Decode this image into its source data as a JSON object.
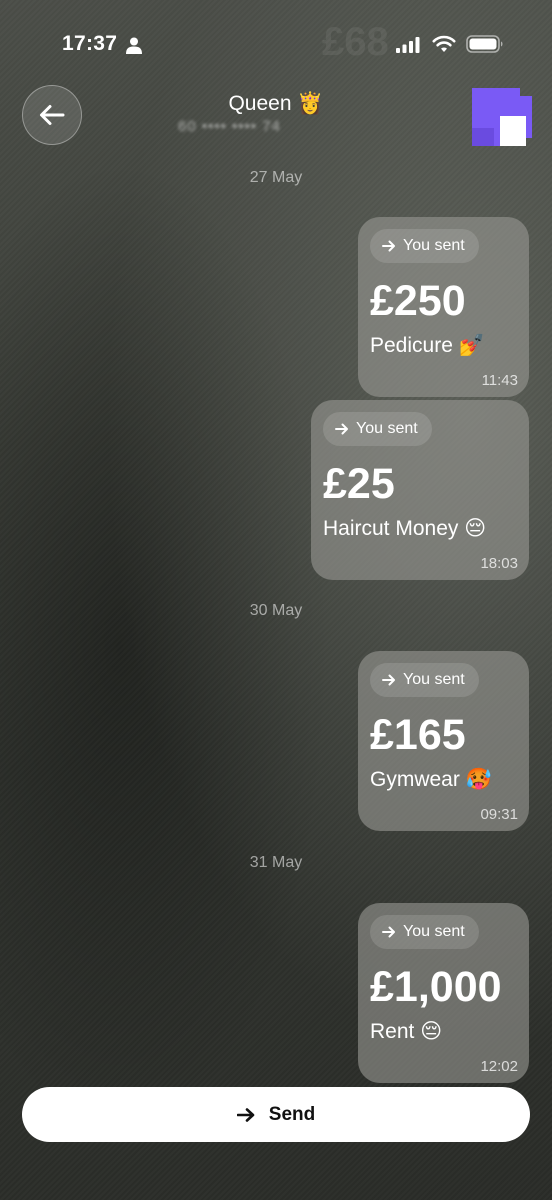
{
  "status_bar": {
    "time": "17:37",
    "person_icon": "person-icon",
    "icons": [
      "signal-icon",
      "wifi-icon",
      "battery-icon"
    ],
    "ghost_amount": "£68"
  },
  "header": {
    "back_icon": "arrow-left-icon",
    "contact_name": "Queen 👸",
    "contact_sub": "60 •••• •••• 74",
    "avatar_color": "#7a5af5"
  },
  "messages": [
    {
      "date": "27 May"
    },
    {
      "pill": "You sent",
      "amount": "£250",
      "note": "Pedicure 💅",
      "time": "11:43"
    },
    {
      "pill": "You sent",
      "amount": "£25",
      "note": "Haircut Money 😔",
      "time": "18:03"
    },
    {
      "date": "30 May"
    },
    {
      "pill": "You sent",
      "amount": "£165",
      "note": "Gymwear 🥵",
      "time": "09:31"
    },
    {
      "date": "31 May"
    },
    {
      "pill": "You sent",
      "amount": "£1,000",
      "note": "Rent 😔",
      "time": "12:02"
    }
  ],
  "footer": {
    "send_label": "Send",
    "send_icon": "arrow-right-icon"
  }
}
